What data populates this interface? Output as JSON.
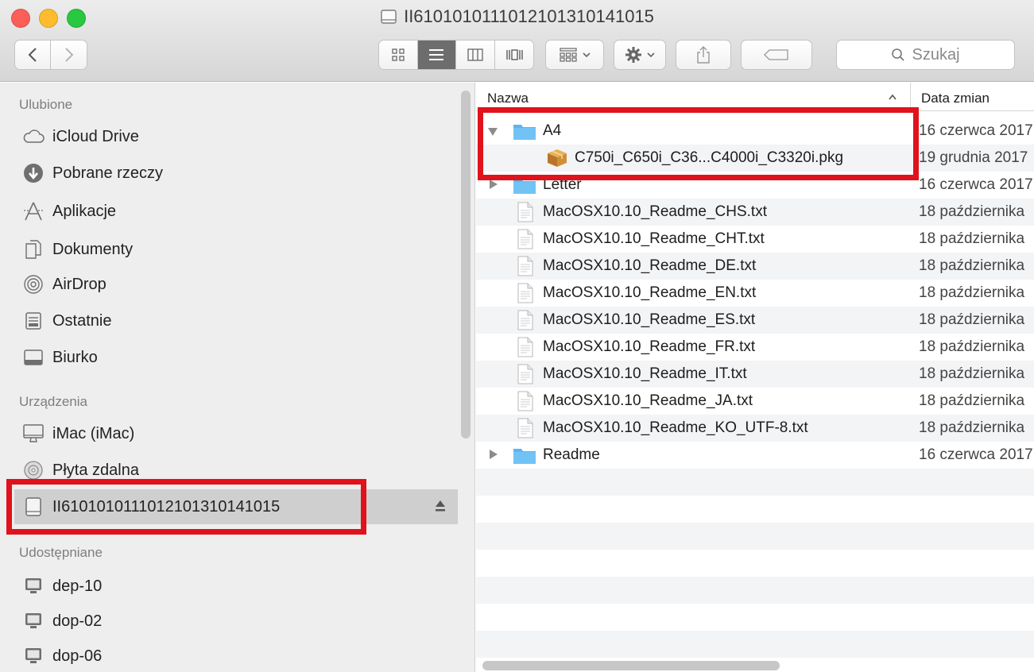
{
  "window": {
    "title": "II6101010111012101310141015"
  },
  "toolbar": {
    "search_placeholder": "Szukaj"
  },
  "sidebar": {
    "sections": {
      "favorites": "Ulubione",
      "devices": "Urządzenia",
      "shared": "Udostępniane"
    },
    "favorites": [
      {
        "label": "iCloud Drive",
        "icon": "cloud-icon"
      },
      {
        "label": "Pobrane rzeczy",
        "icon": "download-icon"
      },
      {
        "label": "Aplikacje",
        "icon": "apps-icon"
      },
      {
        "label": "Dokumenty",
        "icon": "documents-icon"
      },
      {
        "label": "AirDrop",
        "icon": "airdrop-icon"
      },
      {
        "label": "Ostatnie",
        "icon": "recents-icon"
      },
      {
        "label": "Biurko",
        "icon": "desktop-icon"
      }
    ],
    "devices": [
      {
        "label": "iMac (iMac)",
        "icon": "imac-icon"
      },
      {
        "label": "Płyta zdalna",
        "icon": "disc-icon"
      },
      {
        "label": "II6101010111012101310141015",
        "icon": "drive-icon",
        "selected": true
      }
    ],
    "shared": [
      {
        "label": "dep-10",
        "icon": "monitor-icon"
      },
      {
        "label": "dop-02",
        "icon": "monitor-icon"
      },
      {
        "label": "dop-06",
        "icon": "monitor-icon"
      }
    ]
  },
  "list": {
    "columns": {
      "name": "Nazwa",
      "date": "Data zmian"
    },
    "rows": [
      {
        "name": "A4",
        "date": "16 czerwca 2017",
        "kind": "folder",
        "expanded": true,
        "level": 0
      },
      {
        "name": "C750i_C650i_C36...C4000i_C3320i.pkg",
        "date": "19 grudnia 2017",
        "kind": "package",
        "level": 1
      },
      {
        "name": "Letter",
        "date": "16 czerwca 2017",
        "kind": "folder",
        "expanded": false,
        "level": 0
      },
      {
        "name": "MacOSX10.10_Readme_CHS.txt",
        "date": "18 października",
        "kind": "text",
        "level": 0
      },
      {
        "name": "MacOSX10.10_Readme_CHT.txt",
        "date": "18 października",
        "kind": "text",
        "level": 0
      },
      {
        "name": "MacOSX10.10_Readme_DE.txt",
        "date": "18 października",
        "kind": "text",
        "level": 0
      },
      {
        "name": "MacOSX10.10_Readme_EN.txt",
        "date": "18 października",
        "kind": "text",
        "level": 0
      },
      {
        "name": "MacOSX10.10_Readme_ES.txt",
        "date": "18 października",
        "kind": "text",
        "level": 0
      },
      {
        "name": "MacOSX10.10_Readme_FR.txt",
        "date": "18 października",
        "kind": "text",
        "level": 0
      },
      {
        "name": "MacOSX10.10_Readme_IT.txt",
        "date": "18 października",
        "kind": "text",
        "level": 0
      },
      {
        "name": "MacOSX10.10_Readme_JA.txt",
        "date": "18 października",
        "kind": "text",
        "level": 0
      },
      {
        "name": "MacOSX10.10_Readme_KO_UTF-8.txt",
        "date": "18 października",
        "kind": "text",
        "level": 0
      },
      {
        "name": "Readme",
        "date": "16 czerwca 2017",
        "kind": "folder",
        "expanded": false,
        "level": 0
      }
    ]
  },
  "colors": {
    "highlight": "#e0121b",
    "folder": "#5bb5f0",
    "sidebar_bg": "#eeeeee",
    "selection": "#cfcfcf"
  }
}
